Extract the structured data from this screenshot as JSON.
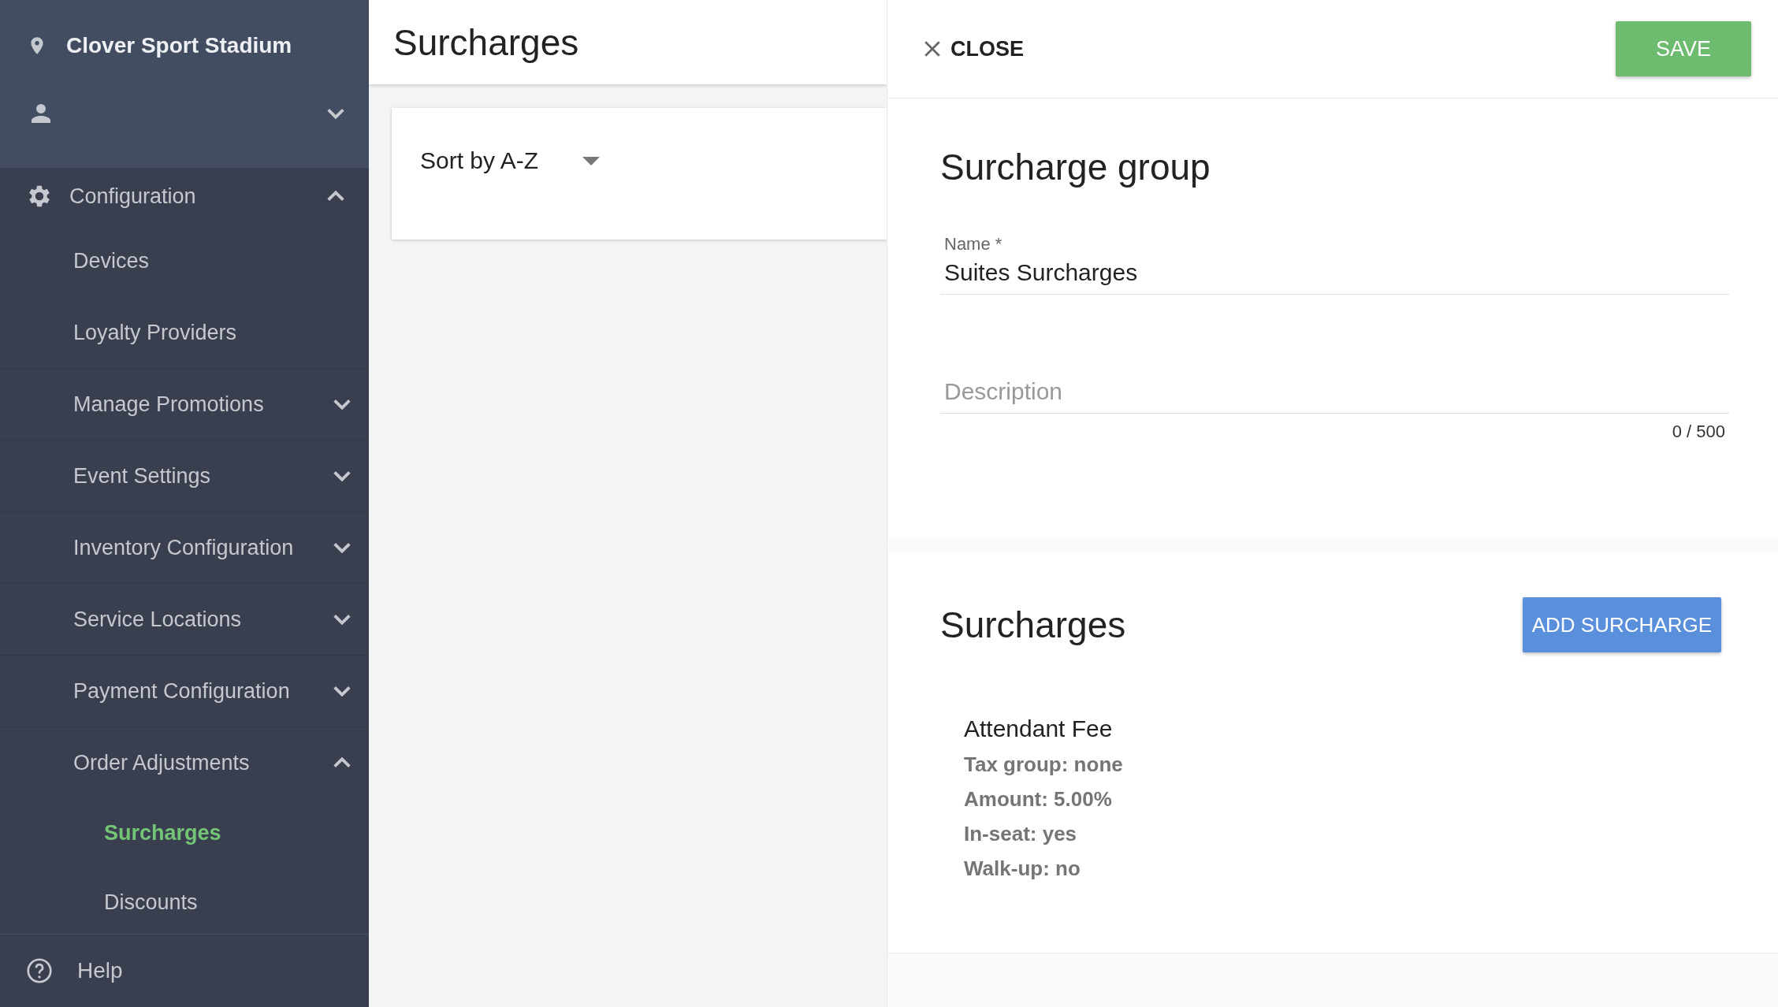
{
  "sidebar": {
    "venue": "Clover Sport Stadium",
    "user": {
      "expanded": false
    },
    "sections": [
      {
        "label": "Configuration",
        "expanded": true,
        "children": [
          {
            "label": "Devices",
            "kind": "link",
            "selected": false
          },
          {
            "label": "Loyalty Providers",
            "kind": "link",
            "selected": false
          },
          {
            "label": "Manage Promotions",
            "kind": "group",
            "expanded": false,
            "selected": false
          },
          {
            "label": "Event Settings",
            "kind": "group",
            "expanded": false,
            "selected": false
          },
          {
            "label": "Inventory Configuration",
            "kind": "group",
            "expanded": false,
            "selected": false
          },
          {
            "label": "Service Locations",
            "kind": "group",
            "expanded": false,
            "selected": false
          },
          {
            "label": "Payment Configuration",
            "kind": "group",
            "expanded": false,
            "selected": false
          },
          {
            "label": "Order Adjustments",
            "kind": "group",
            "expanded": true,
            "selected": false,
            "children": [
              {
                "label": "Surcharges",
                "selected": true
              },
              {
                "label": "Discounts",
                "selected": false
              }
            ]
          }
        ]
      }
    ],
    "help": "Help"
  },
  "list": {
    "title": "Surcharges",
    "sort": "Sort by A-Z"
  },
  "panel": {
    "close": "CLOSE",
    "save": "SAVE",
    "group": {
      "title": "Surcharge group",
      "name": {
        "label": "Name *",
        "value": "Suites Surcharges"
      },
      "description": {
        "placeholder": "Description",
        "counter": "0 / 500"
      }
    },
    "surcharges": {
      "title": "Surcharges",
      "add": "ADD SURCHARGE",
      "items": [
        {
          "name": "Attendant Fee",
          "details": [
            "Tax group: none",
            "Amount: 5.00%",
            "In-seat: yes",
            "Walk-up: no"
          ]
        }
      ]
    }
  }
}
